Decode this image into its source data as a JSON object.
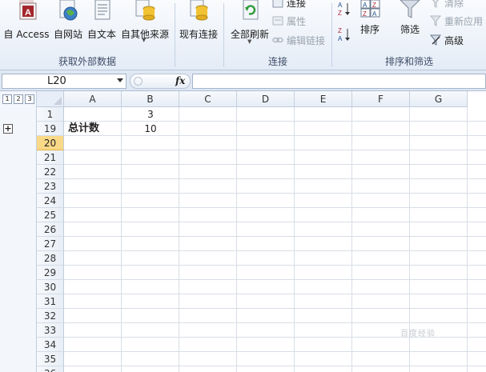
{
  "ribbon": {
    "external_data": {
      "group_label": "获取外部数据",
      "buttons": [
        {
          "label": "自 Access",
          "icon": "access-db-icon"
        },
        {
          "label": "自网站",
          "icon": "globe-icon"
        },
        {
          "label": "自文本",
          "icon": "text-file-icon"
        },
        {
          "label": "自其他来源",
          "icon": "database-stack-icon"
        }
      ]
    },
    "existing_connections": {
      "label": "现有连接",
      "icon": "connection-cylinder-icon"
    },
    "connections": {
      "group_label": "连接",
      "refresh_all": {
        "label": "全部刷新",
        "icon": "refresh-icon"
      },
      "connections": "连接",
      "properties": "属性",
      "edit_links": "编辑链接"
    },
    "sort_filter": {
      "group_label": "排序和筛选",
      "sort": {
        "label": "排序"
      },
      "filter": {
        "label": "筛选"
      },
      "clear": "清除",
      "reapply": "重新应用",
      "advanced": "高级"
    }
  },
  "formula_bar": {
    "name_box": "L20",
    "fx": "fx",
    "formula": ""
  },
  "outline": {
    "levels": [
      "1",
      "2",
      "3"
    ],
    "expand": "+"
  },
  "sheet": {
    "columns": [
      "A",
      "B",
      "C",
      "D",
      "E",
      "F",
      "G"
    ],
    "rows": [
      "1",
      "19",
      "20",
      "21",
      "22",
      "23",
      "24",
      "25",
      "26",
      "27",
      "28",
      "29",
      "30",
      "31",
      "32",
      "33",
      "34",
      "35",
      "36"
    ],
    "active_row": "20",
    "cells": {
      "B1": "3",
      "A19": "总计数",
      "B19": "10"
    }
  },
  "watermark": "百度经验",
  "colors": {
    "active_row_header": "#f9d887",
    "ribbon_bg": "#e4ecf7",
    "grid_line": "#d8dee7"
  }
}
